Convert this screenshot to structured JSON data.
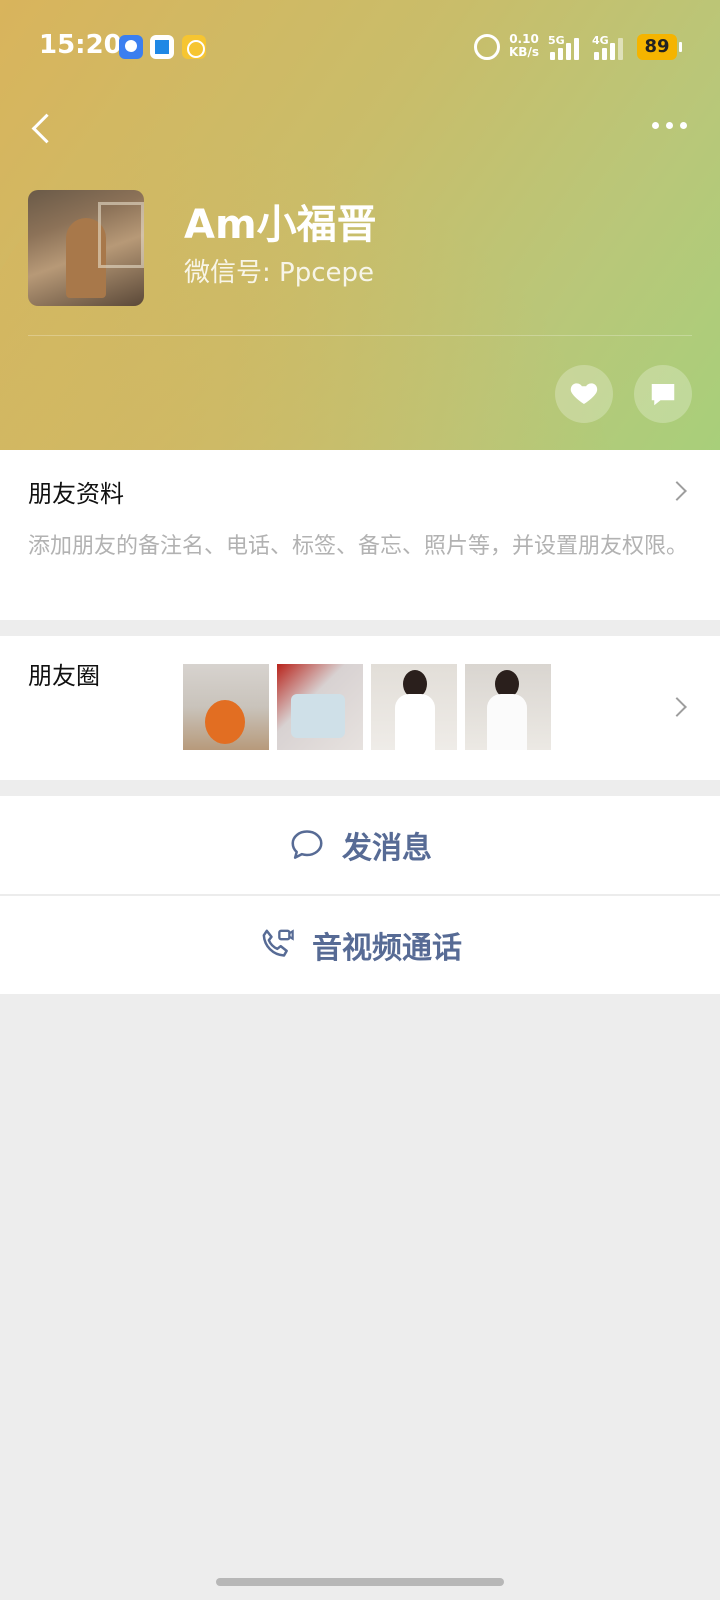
{
  "status_bar": {
    "time": "15:20",
    "net_speed_value": "0.10",
    "net_speed_unit": "KB/s",
    "signal1_label": "5G",
    "signal2_label": "4G",
    "battery": "89"
  },
  "profile": {
    "nickname": "Am小福晋",
    "wechat_id": "微信号: Ppcepe"
  },
  "friend_info": {
    "title": "朋友资料",
    "description": "添加朋友的备注名、电话、标签、备忘、照片等，并设置朋友权限。"
  },
  "moments": {
    "title": "朋友圈"
  },
  "actions": {
    "send_message": "发消息",
    "av_call": "音视频通话"
  },
  "colors": {
    "link_blue": "#576b95",
    "battery_yellow": "#f5b400",
    "page_bg": "#ededed"
  }
}
